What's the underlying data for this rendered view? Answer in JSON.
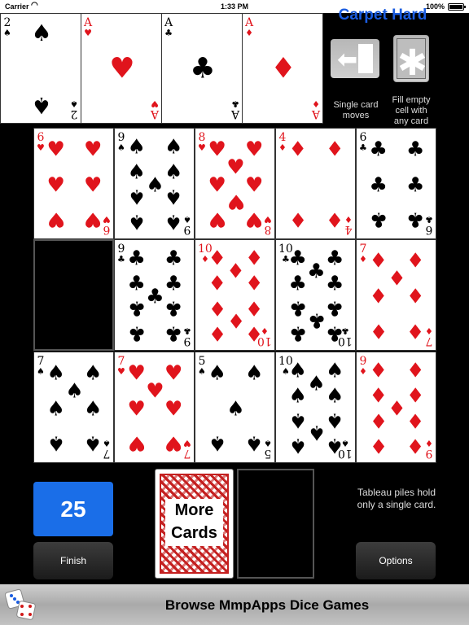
{
  "status": {
    "carrier": "Carrier",
    "time": "1:33 PM",
    "battery": "100%"
  },
  "title": "Carpet Hard",
  "modes": {
    "single": {
      "caption_line1": "Single card",
      "caption_line2": "moves"
    },
    "fill": {
      "caption_line1": "Fill empty",
      "caption_line2": "cell with",
      "caption_line3": "any card"
    }
  },
  "foundations": [
    {
      "rank": "2",
      "suit": "♠",
      "color": "black"
    },
    {
      "rank": "A",
      "suit": "♥",
      "color": "red"
    },
    {
      "rank": "A",
      "suit": "♣",
      "color": "black"
    },
    {
      "rank": "A",
      "suit": "♦",
      "color": "red"
    }
  ],
  "tableau": [
    [
      {
        "rank": "6",
        "suit": "♥",
        "color": "red"
      },
      {
        "rank": "9",
        "suit": "♠",
        "color": "black"
      },
      {
        "rank": "8",
        "suit": "♥",
        "color": "red"
      },
      {
        "rank": "4",
        "suit": "♦",
        "color": "red"
      },
      {
        "rank": "6",
        "suit": "♣",
        "color": "black"
      }
    ],
    [
      null,
      {
        "rank": "9",
        "suit": "♣",
        "color": "black"
      },
      {
        "rank": "10",
        "suit": "♦",
        "color": "red"
      },
      {
        "rank": "10",
        "suit": "♣",
        "color": "black"
      },
      {
        "rank": "7",
        "suit": "♦",
        "color": "red"
      }
    ],
    [
      {
        "rank": "7",
        "suit": "♠",
        "color": "black"
      },
      {
        "rank": "7",
        "suit": "♥",
        "color": "red"
      },
      {
        "rank": "5",
        "suit": "♠",
        "color": "black"
      },
      {
        "rank": "10",
        "suit": "♠",
        "color": "black"
      },
      {
        "rank": "9",
        "suit": "♦",
        "color": "red"
      }
    ]
  ],
  "score": "25",
  "finish_label": "Finish",
  "stock": {
    "line1": "More",
    "line2": "Cards"
  },
  "hint": "Tableau piles hold only a single card.",
  "options_label": "Options",
  "banner": "Browse MmpApps Dice Games"
}
